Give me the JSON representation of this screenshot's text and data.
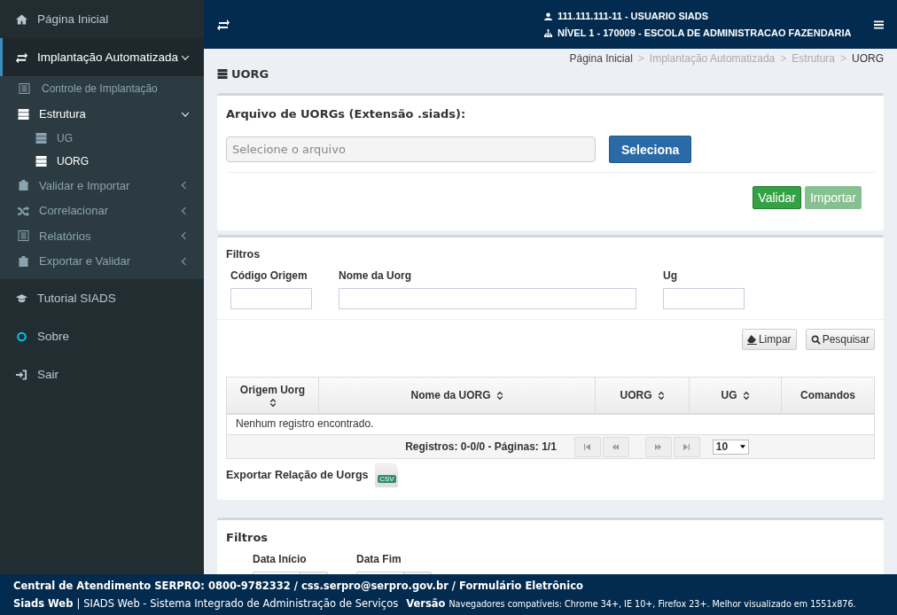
{
  "sidebar": {
    "items": [
      {
        "label": "Página Inicial",
        "selected": false
      },
      {
        "label": "Implantação Automatizada",
        "selected": false,
        "expanded": true,
        "children": [
          {
            "label": "Controle de Implantação",
            "selected": false
          },
          {
            "label": "Estrutura",
            "selected": false,
            "expanded": true,
            "children": [
              {
                "label": "UG",
                "selected": false
              },
              {
                "label": "UORG",
                "selected": true
              }
            ]
          },
          {
            "label": "Validar e Importar",
            "selected": false,
            "expanded": false
          },
          {
            "label": "Correlacionar",
            "selected": false,
            "expanded": false
          },
          {
            "label": "Relatórios",
            "selected": false,
            "expanded": false
          },
          {
            "label": "Exportar e Validar",
            "selected": false,
            "expanded": false
          }
        ]
      },
      {
        "label": "Tutorial SIADS",
        "selected": false
      },
      {
        "label": "Sobre",
        "selected": false
      },
      {
        "label": "Sair",
        "selected": false
      }
    ]
  },
  "header": {
    "user": "111.111.111-11 - USUARIO SIADS",
    "level": "NÍVEL 1 - 170009 - ESCOLA DE ADMINISTRACAO FAZENDARIA"
  },
  "page": {
    "title": "UORG",
    "breadcrumb": [
      {
        "label": "Página Inicial",
        "current": false,
        "muted": false
      },
      {
        "separator": ">",
        "label": "Implantação Automatizada",
        "current": false,
        "muted": true
      },
      {
        "separator": ">",
        "label": "Estrutura",
        "current": false,
        "muted": true
      },
      {
        "separator": ">",
        "label": "UORG",
        "current": true,
        "muted": false
      }
    ]
  },
  "upload": {
    "label": "Arquivo de UORGs (Extensão .siads):",
    "placeholder": "Selecione o arquivo",
    "select_button": "Seleciona",
    "buttons": [
      {
        "label": "Validar",
        "disabled": false
      },
      {
        "label": "Importar",
        "disabled": true
      }
    ]
  },
  "search": {
    "title": "Filtros",
    "fields": [
      {
        "label": "Código Origem"
      },
      {
        "label": "Nome da Uorg"
      },
      {
        "label": "Ug"
      }
    ],
    "clear_button": "Limpar",
    "search_button": "Pesquisar",
    "table": {
      "columns": [
        {
          "label": "Origem Uorg",
          "sortable": true
        },
        {
          "label": "Nome da UORG",
          "sortable": true
        },
        {
          "label": "UORG",
          "sortable": true
        },
        {
          "label": "UG",
          "sortable": true
        },
        {
          "label": "Comandos",
          "sortable": false
        }
      ],
      "empty": "Nenhum registro encontrado.",
      "summary": "Registros: 0-0/0 - Páginas: 1/1",
      "pager": [
        {
          "kind": "first",
          "disabled": true
        },
        {
          "kind": "prev",
          "disabled": true
        },
        {
          "kind": "next",
          "disabled": true
        },
        {
          "kind": "last",
          "disabled": true
        }
      ],
      "page_size": "10"
    },
    "export_label": "Exportar Relação de Uorgs",
    "export_badge": "CSV"
  },
  "dates": {
    "title": "Filtros",
    "fields": [
      {
        "label": "Data Início"
      },
      {
        "label": "Data Fim"
      }
    ]
  },
  "footer": {
    "contact": "Central de Atendimento SERPRO: 0800-9782332 / css.serpro@serpro.gov.br / Formulário Eletrônico",
    "brand": "Siads Web",
    "separator": "|",
    "system": "SIADS Web - Sistema Integrado de Administração de Serviços",
    "version_label": "Versão",
    "browsers": "Navegadores compatíveis: Chrome 34+, IE 10+, Firefox 23+. Melhor visualizado em 1551x876."
  }
}
